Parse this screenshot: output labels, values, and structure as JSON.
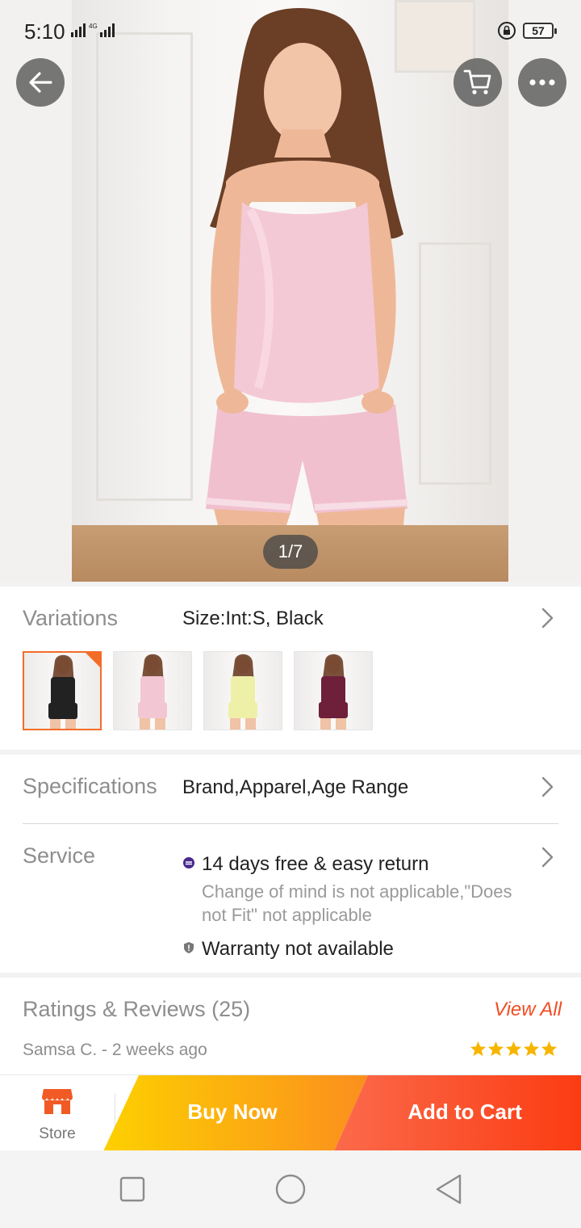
{
  "status_bar": {
    "time": "5:10",
    "network": "4G",
    "battery": "57"
  },
  "hero": {
    "pager": "1/7"
  },
  "variations": {
    "label": "Variations",
    "value": "Size:Int:S, Black",
    "thumbnails": [
      {
        "color_name": "Black",
        "color": "#222222",
        "selected": true
      },
      {
        "color_name": "Pink",
        "color": "#f2c6d2",
        "selected": false
      },
      {
        "color_name": "Yellow",
        "color": "#eef0a8",
        "selected": false
      },
      {
        "color_name": "Burgundy",
        "color": "#6e1f3a",
        "selected": false
      }
    ]
  },
  "specifications": {
    "label": "Specifications",
    "value": "Brand,Apparel,Age Range"
  },
  "service": {
    "label": "Service",
    "return_title": "14 days free & easy return",
    "return_note_line1": "Change of mind is not applicable,\"Does",
    "return_note_line2": "not Fit\" not applicable",
    "warranty": "Warranty not available"
  },
  "ratings": {
    "title": "Ratings & Reviews (25)",
    "view_all": "View All",
    "reviewer": "Samsa C. - 2 weeks ago",
    "stars": 5
  },
  "bottom_bar": {
    "store_label": "Store",
    "buy_now": "Buy Now",
    "add_to_cart": "Add to Cart"
  },
  "colors": {
    "accent_orange": "#f36d29",
    "view_all_red": "#f04e24",
    "buy_now_gradient": [
      "#fdd000",
      "#fb8f1e"
    ],
    "add_to_cart_gradient": [
      "#fb6a4b",
      "#fb3c12"
    ],
    "star": "#f7b500"
  }
}
